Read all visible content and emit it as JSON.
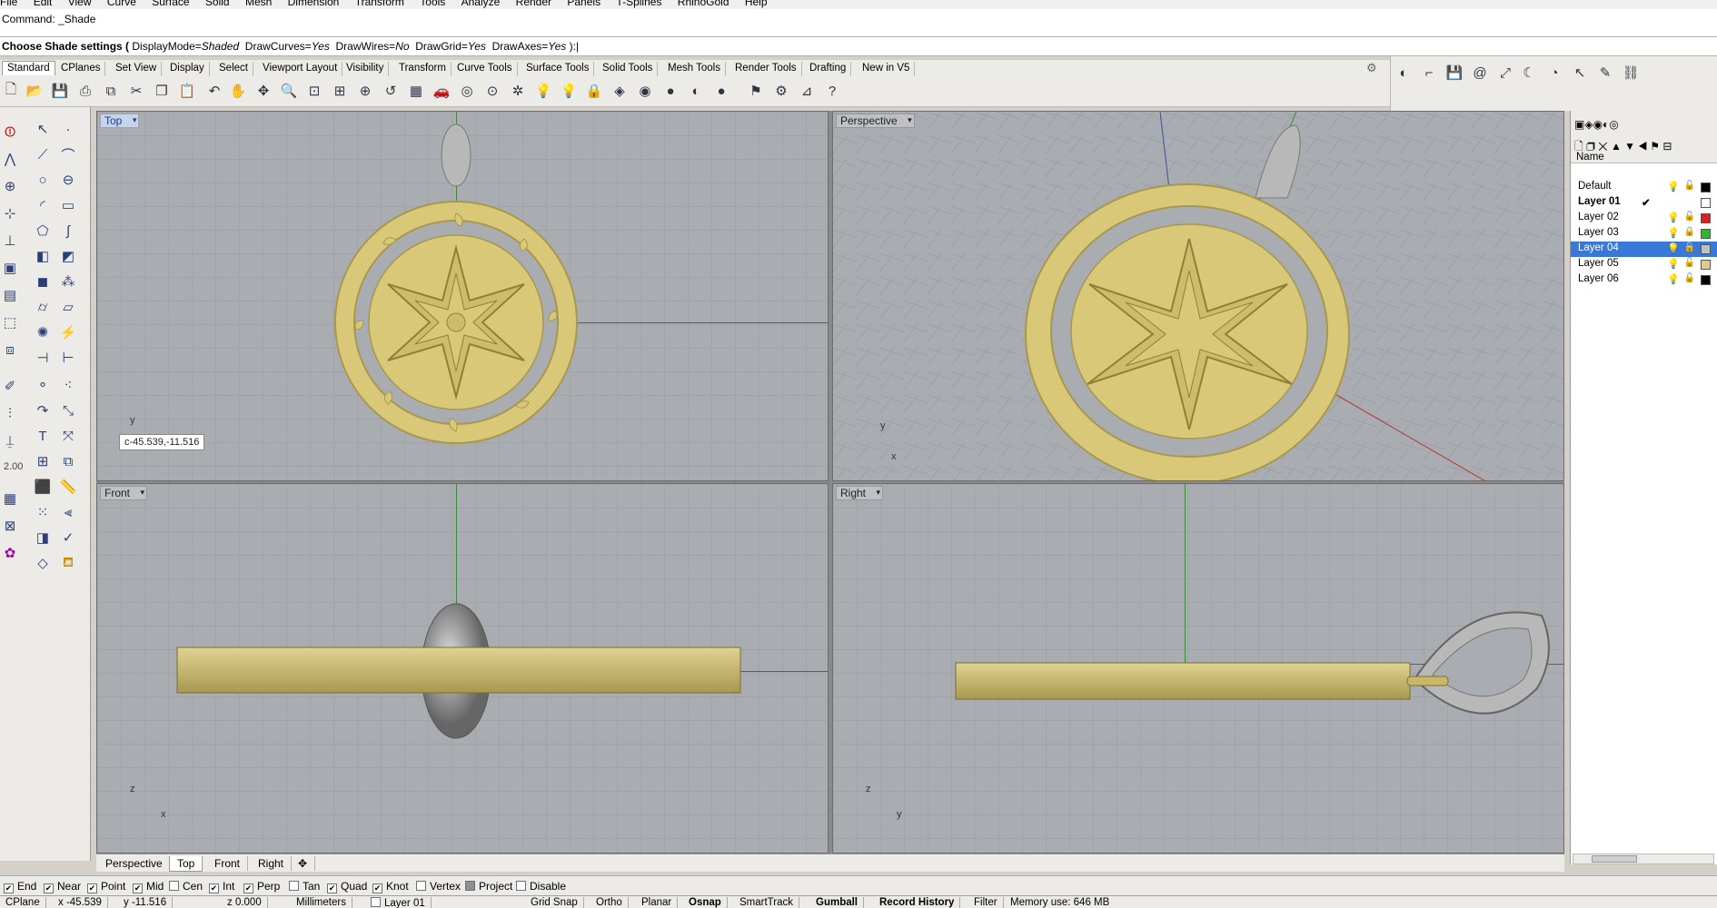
{
  "menu": [
    "File",
    "Edit",
    "View",
    "Curve",
    "Surface",
    "Solid",
    "Mesh",
    "Dimension",
    "Transform",
    "Tools",
    "Analyze",
    "Render",
    "Panels",
    "T-Splines",
    "RhinoGold",
    "Help"
  ],
  "command": {
    "history": "Command: _Shade",
    "prompt_lead": "Choose Shade settings (",
    "options": [
      {
        "name": "DisplayMode=",
        "value": "Shaded"
      },
      {
        "name": "DrawCurves=",
        "value": "Yes"
      },
      {
        "name": "DrawWires=",
        "value": "No"
      },
      {
        "name": "DrawGrid=",
        "value": "Yes"
      },
      {
        "name": "DrawAxes=",
        "value": "Yes"
      }
    ],
    "prompt_tail": "):"
  },
  "toolbar_tabs": [
    "Standard",
    "CPlanes",
    "Set View",
    "Display",
    "Select",
    "Viewport Layout",
    "Visibility",
    "Transform",
    "Curve Tools",
    "Surface Tools",
    "Solid Tools",
    "Mesh Tools",
    "Render Tools",
    "Drafting",
    "New in V5"
  ],
  "viewports": {
    "top": {
      "title": "Top",
      "coord": "c-45.539,-11.516",
      "axis_y": "y"
    },
    "perspective": {
      "title": "Perspective",
      "axis_y": "y",
      "axis_x": "x"
    },
    "front": {
      "title": "Front",
      "axis_z": "z",
      "axis_x": "x"
    },
    "right": {
      "title": "Right",
      "axis_z": "z",
      "axis_y": "y"
    }
  },
  "left_toolbar": {
    "thickness": "2.00"
  },
  "viewport_tabs": [
    "Perspective",
    "Top",
    "Front",
    "Right"
  ],
  "layers": {
    "header": "Name",
    "rows": [
      {
        "name": "Default",
        "color": "#000000"
      },
      {
        "name": "Layer 01",
        "color": "#ffffff",
        "current": "✔"
      },
      {
        "name": "Layer 02",
        "color": "#e02020"
      },
      {
        "name": "Layer 03",
        "color": "#20c020"
      },
      {
        "name": "Layer 04",
        "color": "#c0c0c0"
      },
      {
        "name": "Layer 05",
        "color": "#e8c888"
      },
      {
        "name": "Layer 06",
        "color": "#000000"
      }
    ]
  },
  "osnaps": [
    {
      "label": "End",
      "checked": true
    },
    {
      "label": "Near",
      "checked": true
    },
    {
      "label": "Point",
      "checked": true
    },
    {
      "label": "Mid",
      "checked": true
    },
    {
      "label": "Cen",
      "checked": false
    },
    {
      "label": "Int",
      "checked": true
    },
    {
      "label": "Perp",
      "checked": true
    },
    {
      "label": "Tan",
      "checked": false
    },
    {
      "label": "Quad",
      "checked": true
    },
    {
      "label": "Knot",
      "checked": true
    },
    {
      "label": "Vertex",
      "checked": false
    },
    {
      "label": "Project",
      "checked": true
    },
    {
      "label": "Disable",
      "checked": false
    }
  ],
  "status": {
    "cplane": "CPlane",
    "x": "x -45.539",
    "y": "y -11.516",
    "z": "z 0.000",
    "units": "Millimeters",
    "layer": "Layer 01",
    "buttons": [
      "Grid Snap",
      "Ortho",
      "Planar",
      "Osnap",
      "SmartTrack",
      "Gumball",
      "Record History",
      "Filter"
    ],
    "memory": "Memory use: 646 MB"
  },
  "colors": {
    "gold": "#d8c877",
    "selection": "#3a78d8",
    "axis_x": "#b33333",
    "axis_y": "#3a8a3a"
  }
}
